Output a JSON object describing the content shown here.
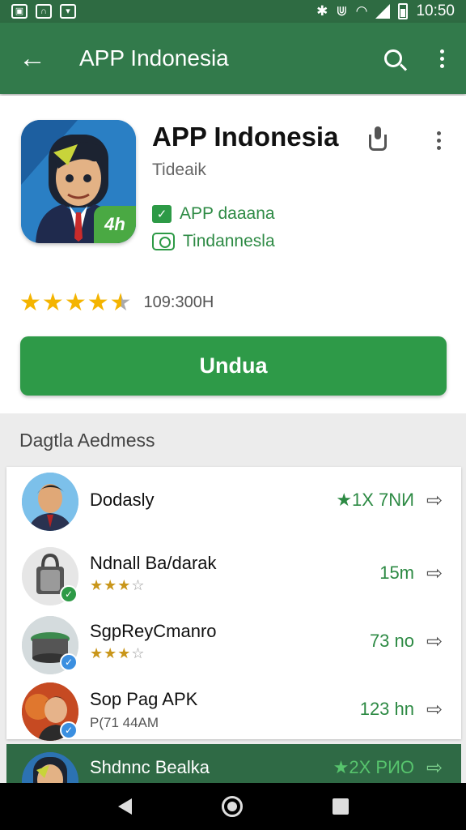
{
  "status_bar": {
    "time": "10:50",
    "left_icons": [
      "image-icon",
      "headset-icon",
      "play-icon"
    ],
    "right_icons": [
      "bluetooth-icon",
      "vibrate-icon",
      "wifi-icon",
      "signal-icon",
      "battery-icon"
    ]
  },
  "app_bar": {
    "title": "APP Indonesia",
    "back_icon": "arrow-left-icon",
    "search_icon": "search-icon",
    "more_icon": "more-vert-icon"
  },
  "app": {
    "title": "APP Indonesia",
    "developer": "Tideaik",
    "badge": "4h",
    "meta_1": "APP daaana",
    "meta_2": "Tindannesla",
    "rating": 4.5,
    "rating_count": "109:300Н",
    "install_label": "Undua"
  },
  "section": {
    "label": "Dagtla Aedmess"
  },
  "list": [
    {
      "title": "Dodasly",
      "meta": "★1X 7NИ",
      "stars": null,
      "sub": null
    },
    {
      "title": "Ndnall Ba/darak",
      "meta": "15m",
      "stars": 3,
      "sub": null
    },
    {
      "title": "SgpReyCmanro",
      "meta": "73 no",
      "stars": 3,
      "sub": null
    },
    {
      "title": "Sop Pag APK",
      "meta": "123 hn",
      "stars": null,
      "sub": "P(71 44AM"
    },
    {
      "title": "Shdnnc Bealka",
      "meta": "★2X РИО",
      "stars": null,
      "sub": null
    }
  ],
  "colors": {
    "app_bar": "#327a4b",
    "status_bar": "#2e6b42",
    "accent_green": "#2e9a48",
    "star": "#f4b400"
  }
}
